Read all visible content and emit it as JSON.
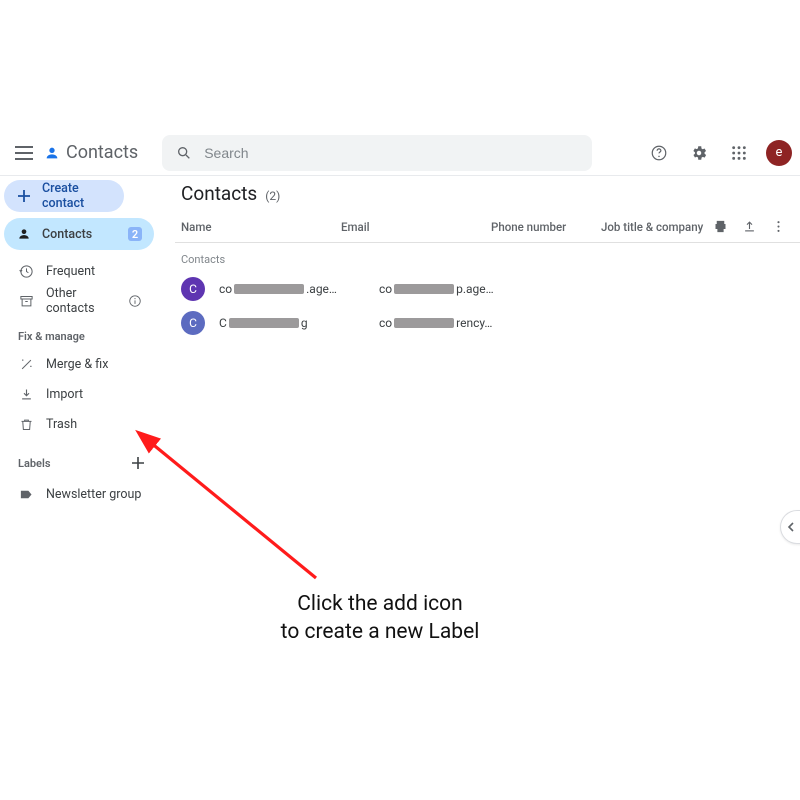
{
  "topbar": {
    "brand": "Contacts",
    "search_placeholder": "Search",
    "avatar_initial": "e"
  },
  "sidebar": {
    "create_label": "Create contact",
    "items": [
      {
        "label": "Contacts",
        "count": "2"
      },
      {
        "label": "Frequent"
      },
      {
        "label": "Other contacts"
      }
    ],
    "fix_manage_header": "Fix & manage",
    "fix_items": [
      {
        "label": "Merge & fix"
      },
      {
        "label": "Import"
      },
      {
        "label": "Trash"
      }
    ],
    "labels_header": "Labels",
    "labels": [
      {
        "label": "Newsletter group"
      }
    ]
  },
  "main": {
    "title": "Contacts",
    "count_display": "(2)",
    "columns": {
      "name": "Name",
      "email": "Email",
      "phone": "Phone number",
      "job": "Job title & company"
    },
    "group_header": "Contacts",
    "rows": [
      {
        "initial": "C",
        "avatar_class": "avp",
        "name_prefix": "co",
        "name_suffix": ".age…",
        "email_prefix": "co",
        "email_suffix": "p.age…"
      },
      {
        "initial": "C",
        "avatar_class": "avb",
        "name_prefix": "C",
        "name_suffix": "g",
        "email_prefix": "co",
        "email_suffix": "rency…"
      }
    ]
  },
  "annotation": {
    "line1": "Click the add icon",
    "line2": "to create a new Label"
  }
}
